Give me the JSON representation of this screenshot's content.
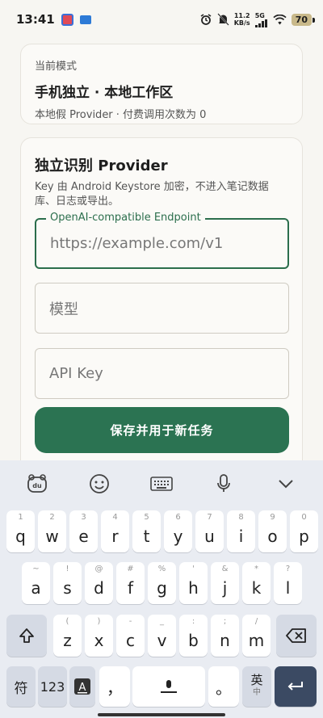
{
  "status": {
    "time": "13:41",
    "speed_value": "11.2",
    "speed_unit": "KB/s",
    "network": "5G",
    "battery": "70"
  },
  "mode_card": {
    "label": "当前模式",
    "title": "手机独立 · 本地工作区",
    "subtitle": "本地假 Provider · 付费调用次数为 0"
  },
  "provider_card": {
    "title": "独立识别 Provider",
    "description": "Key 由 Android Keystore 加密，不进入笔记数据库、日志或导出。",
    "endpoint_legend": "OpenAI-compatible Endpoint",
    "endpoint_placeholder": "https://example.com/v1",
    "model_placeholder": "模型",
    "apikey_placeholder": "API Key",
    "save_label": "保存并用于新任务"
  },
  "keyboard": {
    "row1": [
      {
        "main": "q",
        "hint": "1"
      },
      {
        "main": "w",
        "hint": "2"
      },
      {
        "main": "e",
        "hint": "3"
      },
      {
        "main": "r",
        "hint": "4"
      },
      {
        "main": "t",
        "hint": "5"
      },
      {
        "main": "y",
        "hint": "6"
      },
      {
        "main": "u",
        "hint": "7"
      },
      {
        "main": "i",
        "hint": "8"
      },
      {
        "main": "o",
        "hint": "9"
      },
      {
        "main": "p",
        "hint": "0"
      }
    ],
    "row2": [
      {
        "main": "a",
        "hint": "~"
      },
      {
        "main": "s",
        "hint": "!"
      },
      {
        "main": "d",
        "hint": "@"
      },
      {
        "main": "f",
        "hint": "#"
      },
      {
        "main": "g",
        "hint": "%"
      },
      {
        "main": "h",
        "hint": "'"
      },
      {
        "main": "j",
        "hint": "&"
      },
      {
        "main": "k",
        "hint": "*"
      },
      {
        "main": "l",
        "hint": "?"
      }
    ],
    "row3": [
      {
        "main": "z",
        "hint": "("
      },
      {
        "main": "x",
        "hint": ")"
      },
      {
        "main": "c",
        "hint": "-"
      },
      {
        "main": "v",
        "hint": "_"
      },
      {
        "main": "b",
        "hint": ":"
      },
      {
        "main": "n",
        "hint": ";"
      },
      {
        "main": "m",
        "hint": "/"
      }
    ],
    "symbol_key": "符",
    "number_key": "123",
    "comma_key": "，",
    "period_key": "。",
    "lang_key": "英",
    "lang_sub": "中"
  },
  "colors": {
    "accent": "#2b7352",
    "background": "#f7f6f2"
  }
}
